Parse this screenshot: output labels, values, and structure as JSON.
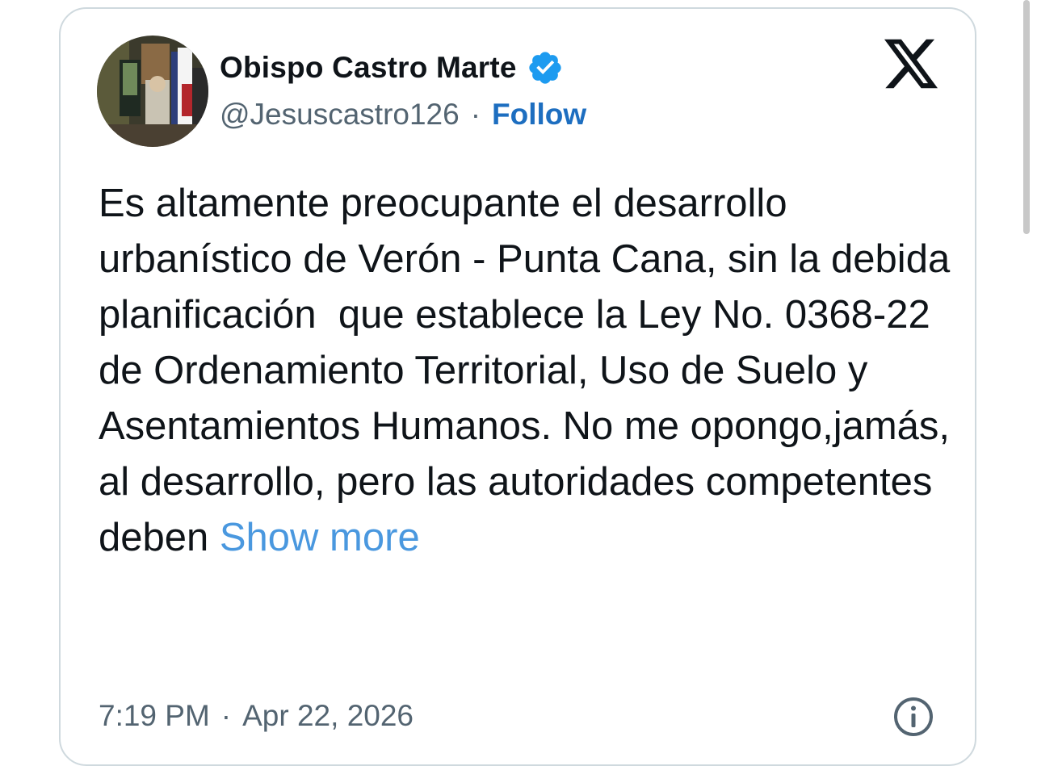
{
  "author": {
    "display_name": "Obispo Castro Marte",
    "handle": "@Jesuscastro126",
    "separator": "·",
    "follow_label": "Follow",
    "verified_icon": "verified-badge-icon",
    "avatar_icon": "profile-photo"
  },
  "platform_icon": "x-logo-icon",
  "tweet": {
    "text": "Es altamente preocupante el desarrollo urbanístico de Verón - Punta Cana, sin la debida planificación  que establece la Ley No. 0368-22 de Ordenamiento Territorial, Uso de Suelo y Asentamientos Humanos. No me opongo,jamás, al desarrollo, pero las autoridades competentes deben ",
    "show_more_label": "Show more"
  },
  "meta": {
    "time": "7:19 PM",
    "separator": "·",
    "date": "Apr 22, 2026",
    "info_icon": "info-icon"
  },
  "colors": {
    "accent": "#1d9bf0",
    "follow": "#1d6ec0",
    "show_more": "#4a98df",
    "text": "#0f1419",
    "secondary": "#536471",
    "border": "#cfd9de"
  }
}
